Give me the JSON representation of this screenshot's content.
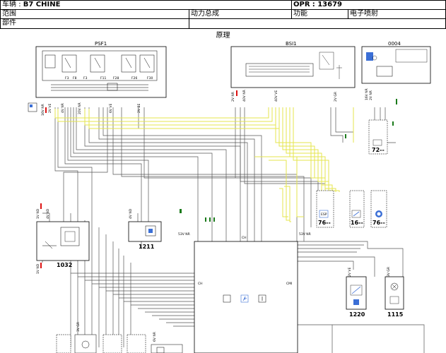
{
  "header": {
    "vehicle_label": "车辆",
    "vehicle_value": "B7 CHINE",
    "opr_label": "OPR",
    "opr_value": "13679",
    "scope_label": "范围",
    "scope_value": "动力总成",
    "function_label": "功能",
    "function_value": "电子喷射",
    "part_label": "部件"
  },
  "section_title": "原理",
  "components": {
    "psf1": "PSF1",
    "bsi1": "BSI1",
    "c0004": "0004",
    "c1032": "1032",
    "c1211": "1211",
    "c1220": "1220",
    "c1115": "1115",
    "c72": "72--",
    "c76a": "76--",
    "c16": "16--",
    "c76b": "76--",
    "ecu_ch": "CH",
    "ecu_cmi": "CMI"
  },
  "connector_labels": {
    "psf1_left": "16V NR",
    "psf1_a": "2V VE",
    "psf1_b": "4V NR",
    "psf1_c": "20V NR",
    "psf1_d": "6V VE",
    "psf1_e": "2V BE",
    "bsi_a": "2V NR",
    "bsi_b": "40V NR",
    "bsi_c": "40V VE",
    "bsi_d": "2V GR",
    "c0004_a": "16V NR",
    "c0004_b": "2V NR",
    "c1032_a": "1V ND",
    "c1032_b": "4V ND",
    "c1032_c": "1V ND",
    "c1211": "4V ND",
    "ecu_left": "53V NR",
    "ecu_right": "53V NR",
    "c1220": "2V VE",
    "c1115": "3V GR",
    "bottom_a": "3V GR",
    "bottom_b": "6V NR"
  },
  "wire_colors": {
    "wire": "#555555",
    "signal": "#e6e64d",
    "red_text": "#d11111",
    "green_text": "#1a7a1a"
  }
}
